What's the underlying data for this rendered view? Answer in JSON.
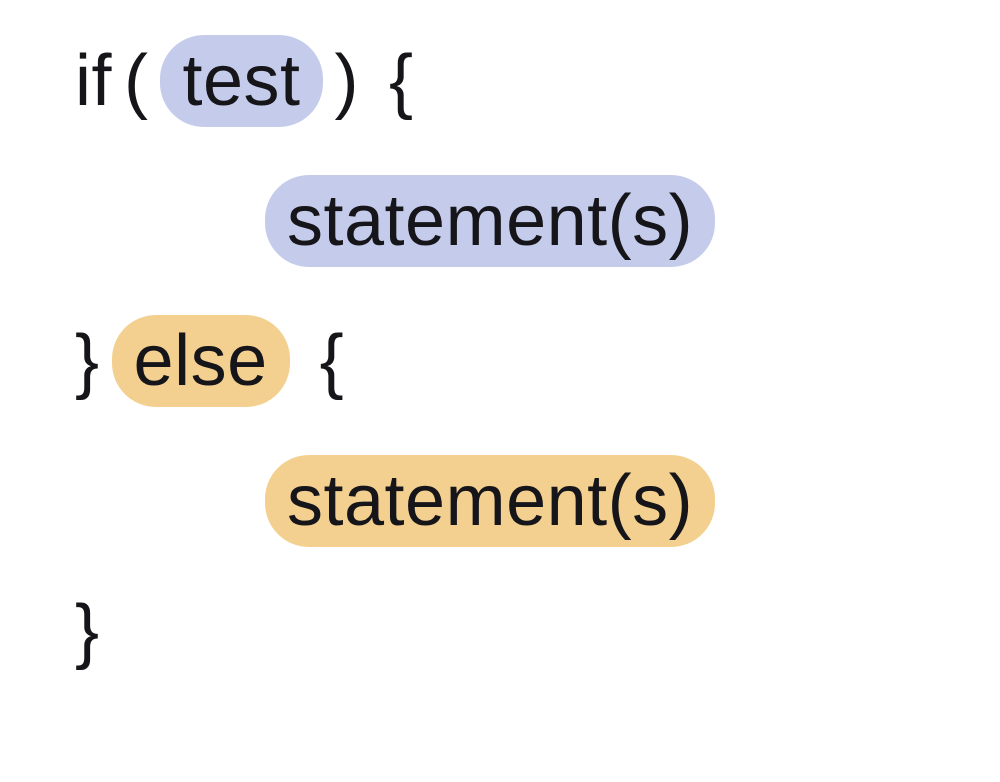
{
  "lines": {
    "line1": {
      "if_keyword": "if",
      "open_paren": "(",
      "test_label": "test",
      "close_paren": ")",
      "open_brace": "{"
    },
    "line2": {
      "statements_label": "statement(s)"
    },
    "line3": {
      "close_brace": "}",
      "else_keyword": "else",
      "open_brace": "{"
    },
    "line4": {
      "statements_label": "statement(s)"
    },
    "line5": {
      "close_brace": "}"
    }
  },
  "colors": {
    "pill_blue": "#c5cceb",
    "pill_yellow": "#f3d08f",
    "text": "#15151a"
  }
}
